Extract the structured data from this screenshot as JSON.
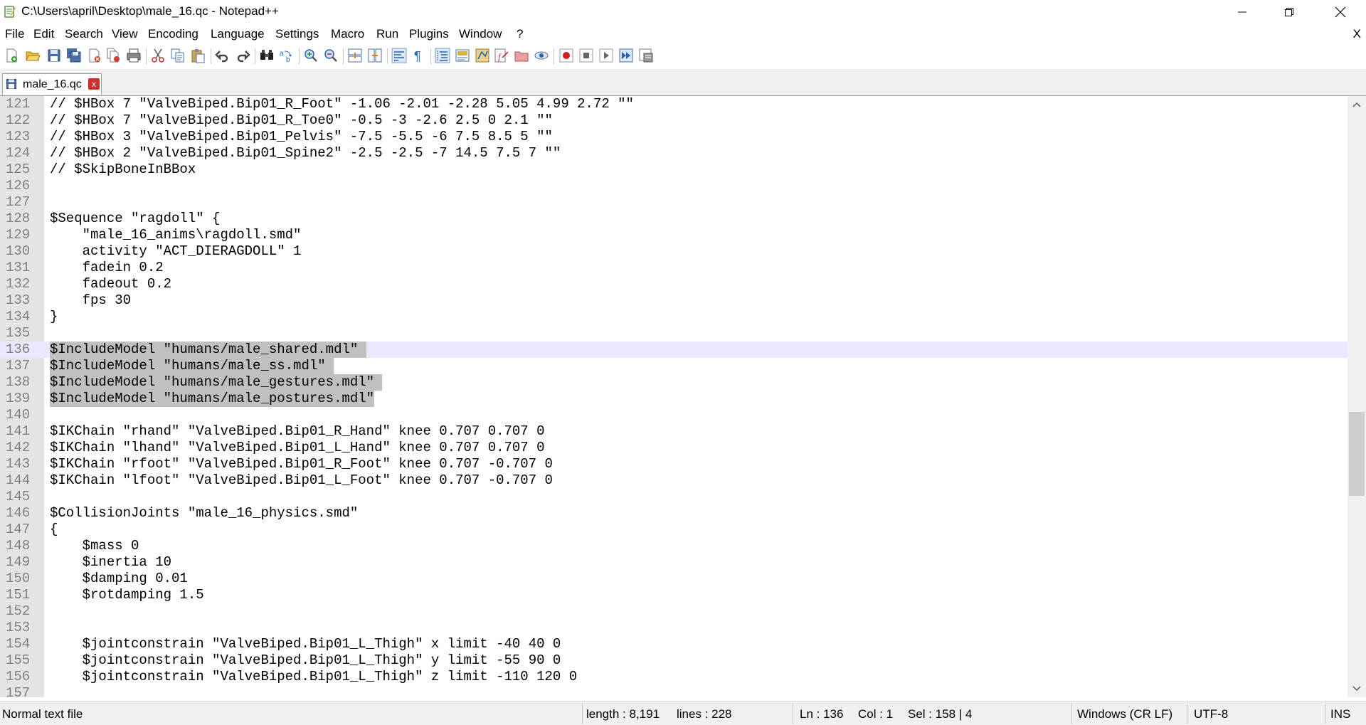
{
  "window": {
    "title": "C:\\Users\\april\\Desktop\\male_16.qc - Notepad++"
  },
  "menu": {
    "items": [
      "File",
      "Edit",
      "Search",
      "View",
      "Encoding",
      "Language",
      "Settings",
      "Macro",
      "Run",
      "Plugins",
      "Window",
      "?"
    ],
    "close_label": "X"
  },
  "toolbar": {
    "icons": [
      "new-file-icon",
      "open-file-icon",
      "save-icon",
      "save-all-icon",
      "close-icon",
      "close-all-icon",
      "print-icon",
      "cut-icon",
      "copy-icon",
      "paste-icon",
      "undo-icon",
      "redo-icon",
      "find-icon",
      "replace-icon",
      "zoom-in-icon",
      "zoom-out-icon",
      "sync-vertical-icon",
      "sync-horizontal-icon",
      "word-wrap-icon",
      "show-all-chars-icon",
      "indent-guide-icon",
      "document-map-icon",
      "function-list-icon",
      "folder-workspace-icon",
      "monitoring-icon",
      "macro-record-icon",
      "macro-stop-icon",
      "macro-play-icon",
      "macro-run-multiple-icon",
      "macro-save-icon"
    ]
  },
  "tab": {
    "label": "male_16.qc",
    "close_glyph": "x"
  },
  "editor": {
    "current_line": "136",
    "lines": [
      {
        "n": "121",
        "text": "// $HBox 7 \"ValveBiped.Bip01_R_Foot\" -1.06 -2.01 -2.28 5.05 4.99 2.72 \"\""
      },
      {
        "n": "122",
        "text": "// $HBox 7 \"ValveBiped.Bip01_R_Toe0\" -0.5 -3 -2.6 2.5 0 2.1 \"\""
      },
      {
        "n": "123",
        "text": "// $HBox 3 \"ValveBiped.Bip01_Pelvis\" -7.5 -5.5 -6 7.5 8.5 5 \"\""
      },
      {
        "n": "124",
        "text": "// $HBox 2 \"ValveBiped.Bip01_Spine2\" -2.5 -2.5 -7 14.5 7.5 7 \"\""
      },
      {
        "n": "125",
        "text": "// $SkipBoneInBBox"
      },
      {
        "n": "126",
        "text": ""
      },
      {
        "n": "127",
        "text": ""
      },
      {
        "n": "128",
        "text": "$Sequence \"ragdoll\" {"
      },
      {
        "n": "129",
        "text": "    \"male_16_anims\\ragdoll.smd\""
      },
      {
        "n": "130",
        "text": "    activity \"ACT_DIERAGDOLL\" 1"
      },
      {
        "n": "131",
        "text": "    fadein 0.2"
      },
      {
        "n": "132",
        "text": "    fadeout 0.2"
      },
      {
        "n": "133",
        "text": "    fps 30"
      },
      {
        "n": "134",
        "text": "}"
      },
      {
        "n": "135",
        "text": ""
      },
      {
        "n": "136",
        "text": "$IncludeModel \"humans/male_shared.mdl\" ",
        "selected": true
      },
      {
        "n": "137",
        "text": "$IncludeModel \"humans/male_ss.mdl\" ",
        "selected": true
      },
      {
        "n": "138",
        "text": "$IncludeModel \"humans/male_gestures.mdl\" ",
        "selected": true
      },
      {
        "n": "139",
        "text": "$IncludeModel \"humans/male_postures.mdl\"",
        "selected": true
      },
      {
        "n": "140",
        "text": ""
      },
      {
        "n": "141",
        "text": "$IKChain \"rhand\" \"ValveBiped.Bip01_R_Hand\" knee 0.707 0.707 0"
      },
      {
        "n": "142",
        "text": "$IKChain \"lhand\" \"ValveBiped.Bip01_L_Hand\" knee 0.707 0.707 0"
      },
      {
        "n": "143",
        "text": "$IKChain \"rfoot\" \"ValveBiped.Bip01_R_Foot\" knee 0.707 -0.707 0"
      },
      {
        "n": "144",
        "text": "$IKChain \"lfoot\" \"ValveBiped.Bip01_L_Foot\" knee 0.707 -0.707 0"
      },
      {
        "n": "145",
        "text": ""
      },
      {
        "n": "146",
        "text": "$CollisionJoints \"male_16_physics.smd\""
      },
      {
        "n": "147",
        "text": "{"
      },
      {
        "n": "148",
        "text": "    $mass 0"
      },
      {
        "n": "149",
        "text": "    $inertia 10"
      },
      {
        "n": "150",
        "text": "    $damping 0.01"
      },
      {
        "n": "151",
        "text": "    $rotdamping 1.5"
      },
      {
        "n": "152",
        "text": ""
      },
      {
        "n": "153",
        "text": ""
      },
      {
        "n": "154",
        "text": "    $jointconstrain \"ValveBiped.Bip01_L_Thigh\" x limit -40 40 0"
      },
      {
        "n": "155",
        "text": "    $jointconstrain \"ValveBiped.Bip01_L_Thigh\" y limit -55 90 0"
      },
      {
        "n": "156",
        "text": "    $jointconstrain \"ValveBiped.Bip01_L_Thigh\" z limit -110 120 0"
      },
      {
        "n": "157",
        "text": ""
      }
    ]
  },
  "status": {
    "file_type": "Normal text file",
    "length": "length : 8,191",
    "lines": "lines : 228",
    "ln": "Ln : 136",
    "col": "Col : 1",
    "sel": "Sel : 158 | 4",
    "eol": "Windows (CR LF)",
    "encoding": "UTF-8",
    "mode": "INS"
  },
  "colors": {
    "selection": "#c0c0c0",
    "current_line": "#e8e8ff",
    "gutter": "#e4e4e4",
    "line_number": "#808080"
  }
}
